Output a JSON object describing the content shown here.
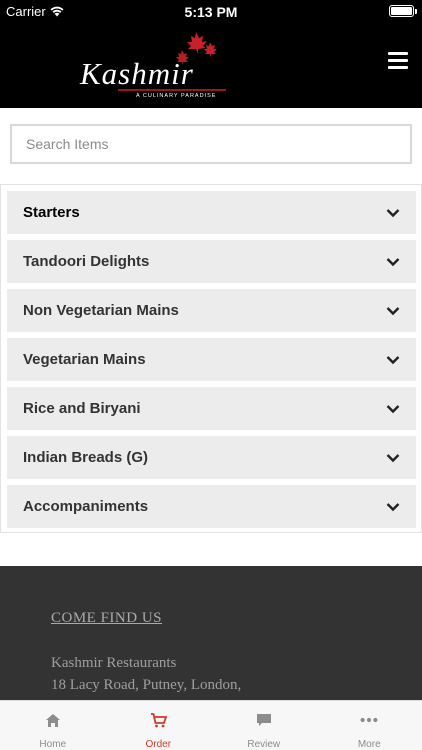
{
  "status_bar": {
    "carrier": "Carrier",
    "time": "5:13 PM"
  },
  "header": {
    "logo_text": "Kashmir",
    "logo_tagline": "A CULINARY PARADISE"
  },
  "search": {
    "placeholder": "Search Items",
    "value": ""
  },
  "categories": [
    {
      "label": "Starters"
    },
    {
      "label": "Tandoori Delights"
    },
    {
      "label": "Non Vegetarian Mains"
    },
    {
      "label": "Vegetarian Mains"
    },
    {
      "label": "Rice and Biryani"
    },
    {
      "label": "Indian Breads (G)"
    },
    {
      "label": "Accompaniments"
    }
  ],
  "footer": {
    "find_title": "COME FIND US",
    "address_line1": "Kashmir Restaurants",
    "address_line2": "18 Lacy Road,  Putney, London,"
  },
  "tabs": [
    {
      "label": "Home",
      "icon": "home-icon"
    },
    {
      "label": "Order",
      "icon": "cart-icon"
    },
    {
      "label": "Review",
      "icon": "comment-icon"
    },
    {
      "label": "More",
      "icon": "more-icon"
    }
  ],
  "colors": {
    "accent": "#d0392b",
    "header_bg": "#000000",
    "footer_bg": "#333333"
  }
}
